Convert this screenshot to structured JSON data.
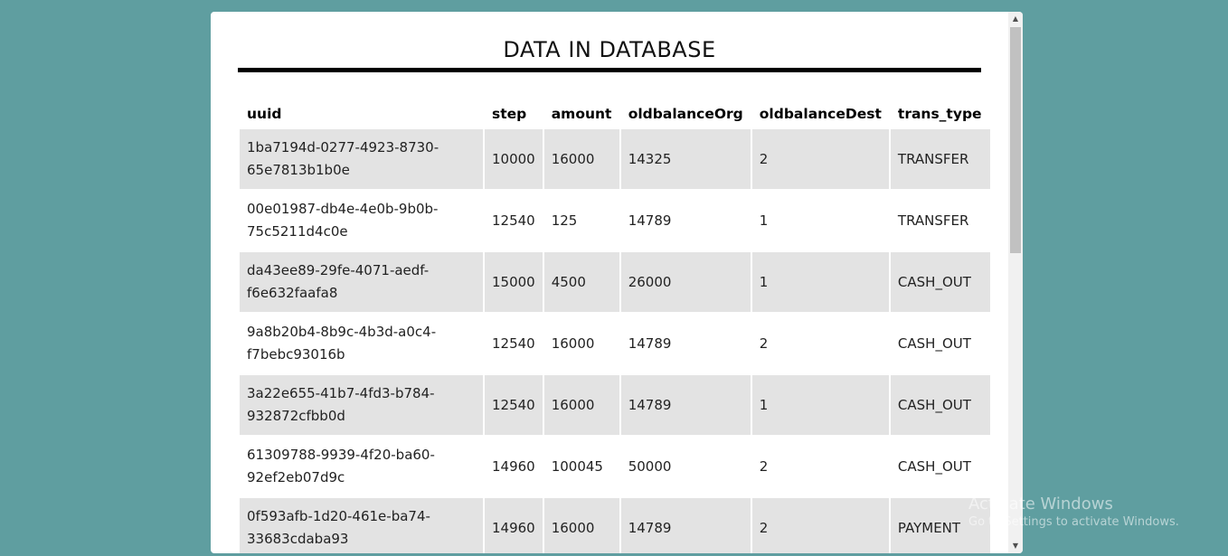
{
  "page": {
    "title": "DATA IN DATABASE"
  },
  "table": {
    "headers": [
      "uuid",
      "step",
      "amount",
      "oldbalanceOrg",
      "oldbalanceDest",
      "trans_type"
    ],
    "rows": [
      {
        "uuid": "1ba7194d-0277-4923-8730-\n65e7813b1b0e",
        "step": "10000",
        "amount": "16000",
        "oldbalanceOrg": "14325",
        "oldbalanceDest": "2",
        "trans_type": "TRANSFER"
      },
      {
        "uuid": "00e01987-db4e-4e0b-9b0b-\n75c5211d4c0e",
        "step": "12540",
        "amount": "125",
        "oldbalanceOrg": "14789",
        "oldbalanceDest": "1",
        "trans_type": "TRANSFER"
      },
      {
        "uuid": "da43ee89-29fe-4071-aedf-\nf6e632faafa8",
        "step": "15000",
        "amount": "4500",
        "oldbalanceOrg": "26000",
        "oldbalanceDest": "1",
        "trans_type": "CASH_OUT"
      },
      {
        "uuid": "9a8b20b4-8b9c-4b3d-a0c4-\nf7bebc93016b",
        "step": "12540",
        "amount": "16000",
        "oldbalanceOrg": "14789",
        "oldbalanceDest": "2",
        "trans_type": "CASH_OUT"
      },
      {
        "uuid": "3a22e655-41b7-4fd3-b784-\n932872cfbb0d",
        "step": "12540",
        "amount": "16000",
        "oldbalanceOrg": "14789",
        "oldbalanceDest": "1",
        "trans_type": "CASH_OUT"
      },
      {
        "uuid": "61309788-9939-4f20-ba60-\n92ef2eb07d9c",
        "step": "14960",
        "amount": "100045",
        "oldbalanceOrg": "50000",
        "oldbalanceDest": "2",
        "trans_type": "CASH_OUT"
      },
      {
        "uuid": "0f593afb-1d20-461e-ba74-\n33683cdaba93",
        "step": "14960",
        "amount": "16000",
        "oldbalanceOrg": "14789",
        "oldbalanceDest": "2",
        "trans_type": "PAYMENT"
      }
    ]
  },
  "watermark": {
    "title": "Activate Windows",
    "subtitle": "Go to Settings to activate Windows."
  },
  "colors": {
    "background": "#5f9ea0",
    "panel": "#ffffff",
    "stripe": "#e3e3e3"
  },
  "icons": {
    "scroll_up": "triangle-up",
    "scroll_down": "triangle-down"
  }
}
